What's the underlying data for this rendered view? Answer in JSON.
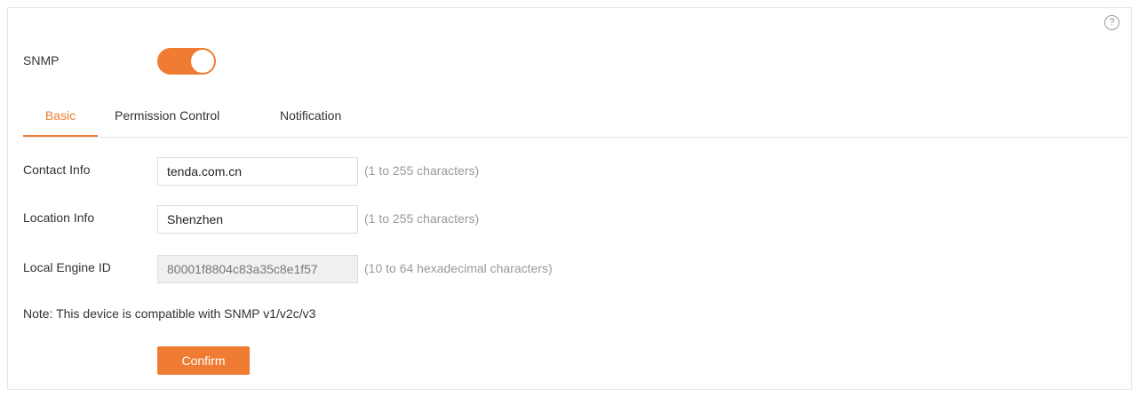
{
  "help": {
    "icon": "help-circle-icon",
    "glyph": "?"
  },
  "snmp": {
    "label": "SNMP",
    "enabled": true,
    "accent": "#f07c33"
  },
  "tabs": [
    {
      "label": "Basic",
      "active": true
    },
    {
      "label": "Permission Control",
      "active": false
    },
    {
      "label": "Notification",
      "active": false
    }
  ],
  "fields": {
    "contact": {
      "label": "Contact Info",
      "value": "tenda.com.cn",
      "hint": "(1 to 255 characters)"
    },
    "location": {
      "label": "Location Info",
      "value": "Shenzhen",
      "hint": "(1 to 255 characters)"
    },
    "engine_id": {
      "label": "Local Engine ID",
      "value": "80001f8804c83a35c8e1f57",
      "hint": "(10 to 64 hexadecimal characters)"
    }
  },
  "note": "Note: This device is compatible with SNMP v1/v2c/v3",
  "confirm_label": "Confirm"
}
